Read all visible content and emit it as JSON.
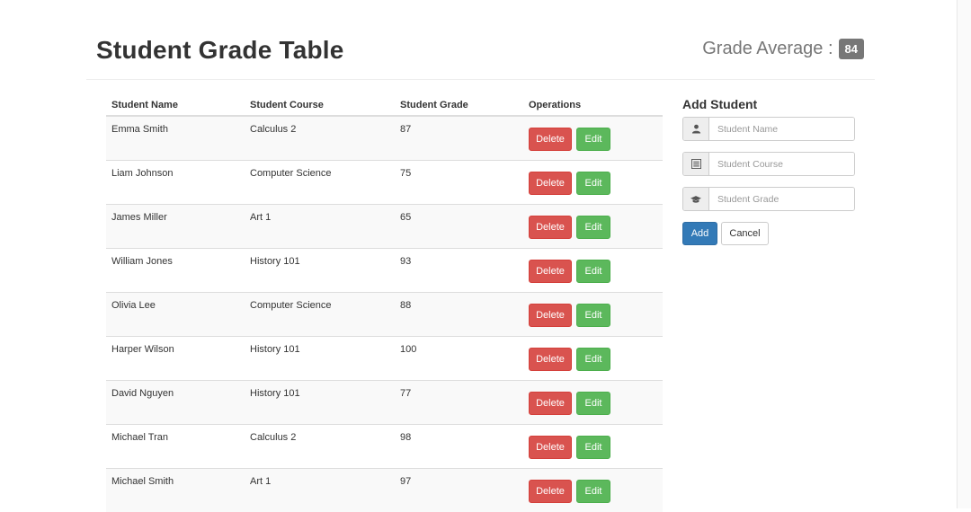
{
  "header": {
    "title": "Student Grade Table",
    "average_label": "Grade Average :",
    "average_value": "84"
  },
  "table": {
    "columns": [
      "Student Name",
      "Student Course",
      "Student Grade",
      "Operations"
    ],
    "rows": [
      {
        "name": "Emma Smith",
        "course": "Calculus 2",
        "grade": "87"
      },
      {
        "name": "Liam Johnson",
        "course": "Computer Science",
        "grade": "75"
      },
      {
        "name": "James Miller",
        "course": "Art 1",
        "grade": "65"
      },
      {
        "name": "William Jones",
        "course": "History 101",
        "grade": "93"
      },
      {
        "name": "Olivia Lee",
        "course": "Computer Science",
        "grade": "88"
      },
      {
        "name": "Harper Wilson",
        "course": "History 101",
        "grade": "100"
      },
      {
        "name": "David Nguyen",
        "course": "History 101",
        "grade": "77"
      },
      {
        "name": "Michael Tran",
        "course": "Calculus 2",
        "grade": "98"
      },
      {
        "name": "Michael Smith",
        "course": "Art 1",
        "grade": "97"
      }
    ],
    "delete_label": "Delete",
    "edit_label": "Edit"
  },
  "form": {
    "title": "Add Student",
    "fields": [
      {
        "icon": "user-icon",
        "placeholder": "Student Name",
        "value": ""
      },
      {
        "icon": "list-icon",
        "placeholder": "Student Course",
        "value": ""
      },
      {
        "icon": "graduation-cap-icon",
        "placeholder": "Student Grade",
        "value": ""
      }
    ],
    "add_label": "Add",
    "cancel_label": "Cancel"
  },
  "colors": {
    "danger": "#d9534f",
    "success": "#5cb85c",
    "primary": "#337ab7",
    "badge": "#777777"
  }
}
